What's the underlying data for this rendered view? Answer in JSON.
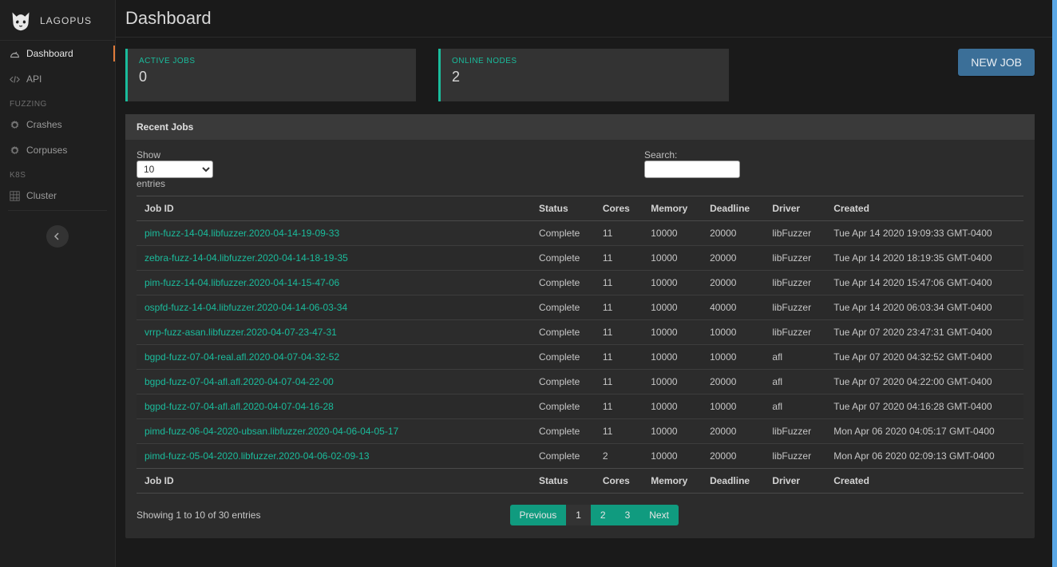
{
  "brand": "LAGOPUS",
  "page_title": "Dashboard",
  "sidebar": {
    "items": [
      {
        "label": "Dashboard",
        "icon": "dashboard-icon",
        "active": true
      },
      {
        "label": "API",
        "icon": "code-icon",
        "active": false
      }
    ],
    "sections": [
      {
        "title": "FUZZING",
        "items": [
          {
            "label": "Crashes",
            "icon": "gear-icon"
          },
          {
            "label": "Corpuses",
            "icon": "gear-icon"
          }
        ]
      },
      {
        "title": "K8S",
        "items": [
          {
            "label": "Cluster",
            "icon": "grid-icon"
          }
        ]
      }
    ]
  },
  "cards": {
    "active_jobs": {
      "label": "ACTIVE JOBS",
      "value": "0"
    },
    "online_nodes": {
      "label": "ONLINE NODES",
      "value": "2"
    }
  },
  "buttons": {
    "new_job": "NEW JOB"
  },
  "panel": {
    "title": "Recent Jobs"
  },
  "table": {
    "show_label": "Show",
    "entries_label": "entries",
    "length_value": "10",
    "search_label": "Search:",
    "columns": [
      "Job ID",
      "Status",
      "Cores",
      "Memory",
      "Deadline",
      "Driver",
      "Created"
    ],
    "rows": [
      {
        "job_id": "pim-fuzz-14-04.libfuzzer.2020-04-14-19-09-33",
        "status": "Complete",
        "cores": "11",
        "memory": "10000",
        "deadline": "20000",
        "driver": "libFuzzer",
        "created": "Tue Apr 14 2020 19:09:33 GMT-0400"
      },
      {
        "job_id": "zebra-fuzz-14-04.libfuzzer.2020-04-14-18-19-35",
        "status": "Complete",
        "cores": "11",
        "memory": "10000",
        "deadline": "20000",
        "driver": "libFuzzer",
        "created": "Tue Apr 14 2020 18:19:35 GMT-0400"
      },
      {
        "job_id": "pim-fuzz-14-04.libfuzzer.2020-04-14-15-47-06",
        "status": "Complete",
        "cores": "11",
        "memory": "10000",
        "deadline": "20000",
        "driver": "libFuzzer",
        "created": "Tue Apr 14 2020 15:47:06 GMT-0400"
      },
      {
        "job_id": "ospfd-fuzz-14-04.libfuzzer.2020-04-14-06-03-34",
        "status": "Complete",
        "cores": "11",
        "memory": "10000",
        "deadline": "40000",
        "driver": "libFuzzer",
        "created": "Tue Apr 14 2020 06:03:34 GMT-0400"
      },
      {
        "job_id": "vrrp-fuzz-asan.libfuzzer.2020-04-07-23-47-31",
        "status": "Complete",
        "cores": "11",
        "memory": "10000",
        "deadline": "10000",
        "driver": "libFuzzer",
        "created": "Tue Apr 07 2020 23:47:31 GMT-0400"
      },
      {
        "job_id": "bgpd-fuzz-07-04-real.afl.2020-04-07-04-32-52",
        "status": "Complete",
        "cores": "11",
        "memory": "10000",
        "deadline": "10000",
        "driver": "afl",
        "created": "Tue Apr 07 2020 04:32:52 GMT-0400"
      },
      {
        "job_id": "bgpd-fuzz-07-04-afl.afl.2020-04-07-04-22-00",
        "status": "Complete",
        "cores": "11",
        "memory": "10000",
        "deadline": "20000",
        "driver": "afl",
        "created": "Tue Apr 07 2020 04:22:00 GMT-0400"
      },
      {
        "job_id": "bgpd-fuzz-07-04-afl.afl.2020-04-07-04-16-28",
        "status": "Complete",
        "cores": "11",
        "memory": "10000",
        "deadline": "10000",
        "driver": "afl",
        "created": "Tue Apr 07 2020 04:16:28 GMT-0400"
      },
      {
        "job_id": "pimd-fuzz-06-04-2020-ubsan.libfuzzer.2020-04-06-04-05-17",
        "status": "Complete",
        "cores": "11",
        "memory": "10000",
        "deadline": "20000",
        "driver": "libFuzzer",
        "created": "Mon Apr 06 2020 04:05:17 GMT-0400"
      },
      {
        "job_id": "pimd-fuzz-05-04-2020.libfuzzer.2020-04-06-02-09-13",
        "status": "Complete",
        "cores": "2",
        "memory": "10000",
        "deadline": "20000",
        "driver": "libFuzzer",
        "created": "Mon Apr 06 2020 02:09:13 GMT-0400"
      }
    ],
    "info": "Showing 1 to 10 of 30 entries",
    "pager": {
      "prev": "Previous",
      "pages": [
        "1",
        "2",
        "3"
      ],
      "next": "Next",
      "active": "1"
    }
  }
}
